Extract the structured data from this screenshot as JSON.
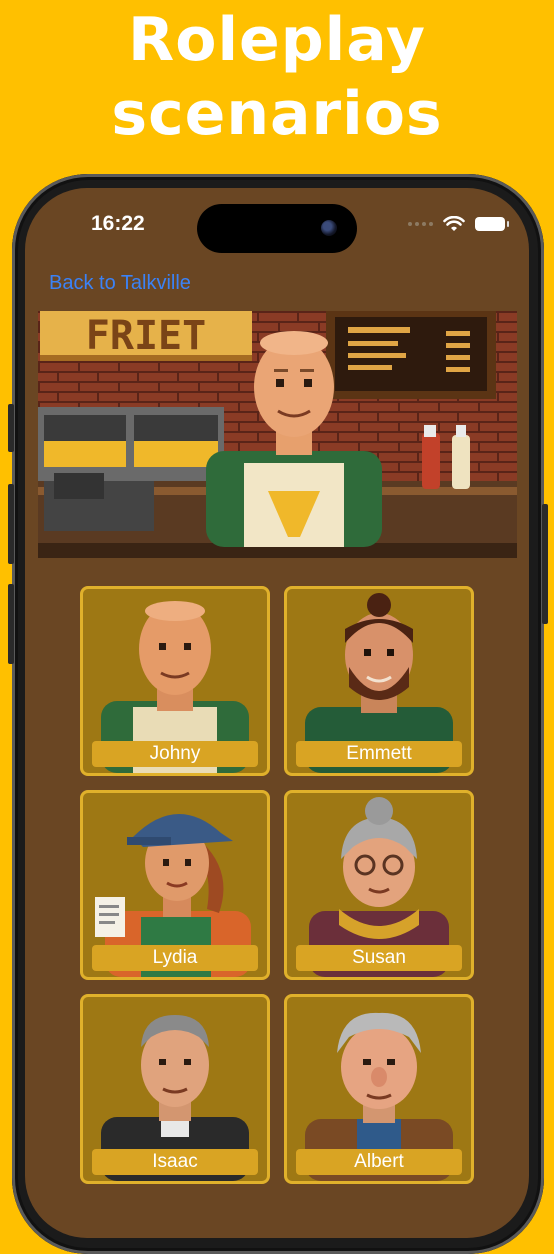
{
  "headline": {
    "line1": "Roleplay",
    "line2": "scenarios"
  },
  "status_bar": {
    "time": "16:22"
  },
  "nav": {
    "back_label": "Back to Talkville"
  },
  "hero": {
    "sign_text": "FRIET"
  },
  "characters": [
    {
      "name": "Johny"
    },
    {
      "name": "Emmett"
    },
    {
      "name": "Lydia"
    },
    {
      "name": "Susan"
    },
    {
      "name": "Isaac"
    },
    {
      "name": "Albert"
    }
  ],
  "colors": {
    "background": "#FFC000",
    "screen": "#6A4623",
    "card": "#9E7814",
    "card_border": "#E0B12B",
    "label": "#D9A423",
    "link": "#3B82F6"
  }
}
